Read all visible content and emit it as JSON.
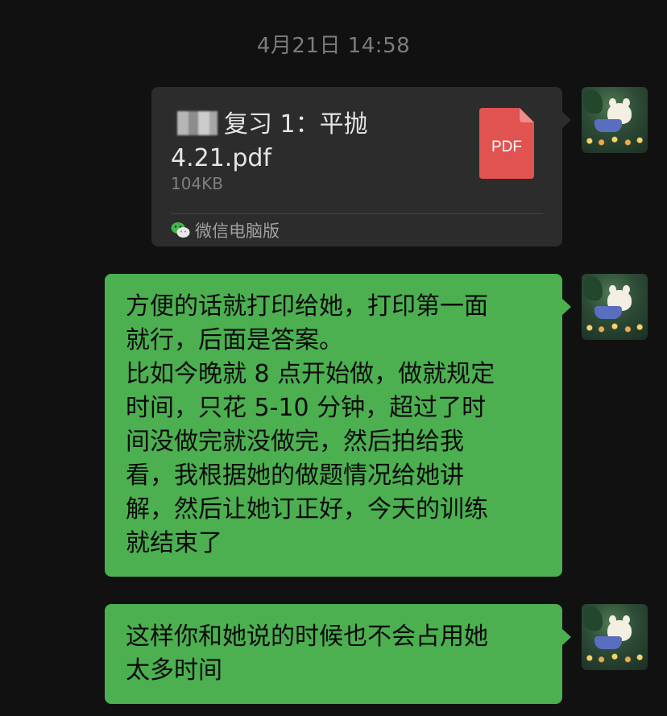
{
  "chat": {
    "timestamp": "4月21日 14:58",
    "file_message": {
      "file_name": "复习 1：平抛 4.21.pdf",
      "file_name_line1": "复习 1：平抛",
      "file_name_line2": "4.21.pdf",
      "file_size": "104KB",
      "file_type": "PDF",
      "source": "微信电脑版",
      "icon": "pdf-file-icon"
    },
    "messages": [
      {
        "text": "方便的话就打印给她，打印第一面\n就行，后面是答案。\n比如今晚就 8 点开始做，做就规定\n时间，只花 5-10 分钟，超过了时\n间没做完就没做完，然后拍给我\n看，我根据她的做题情况给她讲\n解，然后让她订正好，今天的训练\n就结束了"
      },
      {
        "text": "这样你和她说的时候也不会占用她\n太多时间"
      }
    ]
  },
  "colors": {
    "background": "#111111",
    "file_bubble": "#2c2c2c",
    "sent_bubble": "#4caf50",
    "pdf_icon": "#e05350",
    "timestamp_text": "#7c7c7c"
  }
}
